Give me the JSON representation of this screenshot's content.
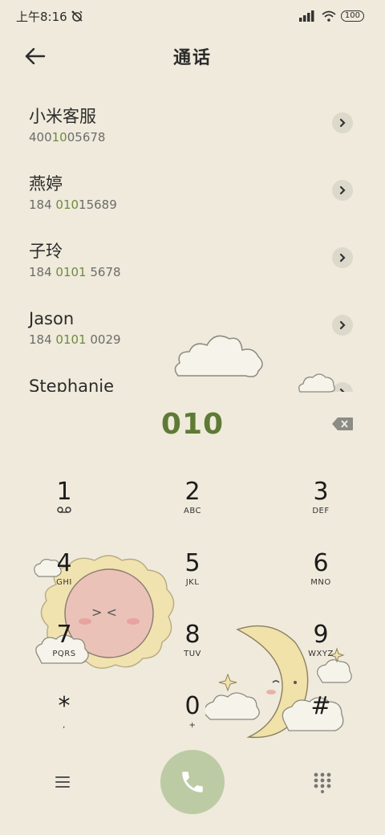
{
  "status_bar": {
    "time": "上午8:16",
    "battery": "100",
    "icons": [
      "alarm-off-icon",
      "signal-icon",
      "wifi-icon",
      "battery-icon"
    ]
  },
  "header": {
    "title": "通话",
    "back_icon": "arrow-left-icon"
  },
  "contacts": [
    {
      "name": "小米客服",
      "number_pre": "400",
      "number_hl": "10",
      "number_post": "05678"
    },
    {
      "name": "燕婷",
      "number_pre": "184 ",
      "number_hl": "010",
      "number_post": "15689"
    },
    {
      "name": "子玲",
      "number_pre": "184 ",
      "number_hl": "0101",
      "number_post": " 5678"
    },
    {
      "name": "Jason",
      "number_pre": "184 ",
      "number_hl": "0101",
      "number_post": " 0029"
    },
    {
      "name": "Stephanie",
      "number_pre": "",
      "number_hl": "",
      "number_post": ""
    }
  ],
  "dialer": {
    "input": "010"
  },
  "keypad": [
    {
      "digit": "1",
      "letters": ""
    },
    {
      "digit": "2",
      "letters": "ABC"
    },
    {
      "digit": "3",
      "letters": "DEF"
    },
    {
      "digit": "4",
      "letters": "GHI"
    },
    {
      "digit": "5",
      "letters": "JKL"
    },
    {
      "digit": "6",
      "letters": "MNO"
    },
    {
      "digit": "7",
      "letters": "PQRS"
    },
    {
      "digit": "8",
      "letters": "TUV"
    },
    {
      "digit": "9",
      "letters": "WXYZ"
    },
    {
      "digit": "*",
      "letters": ","
    },
    {
      "digit": "0",
      "letters": "+"
    },
    {
      "digit": "#",
      "letters": ""
    }
  ],
  "colors": {
    "background": "#efeadb",
    "accent": "#5e7a35",
    "call_button": "#bccba3",
    "highlight": "#6e8a3f"
  }
}
